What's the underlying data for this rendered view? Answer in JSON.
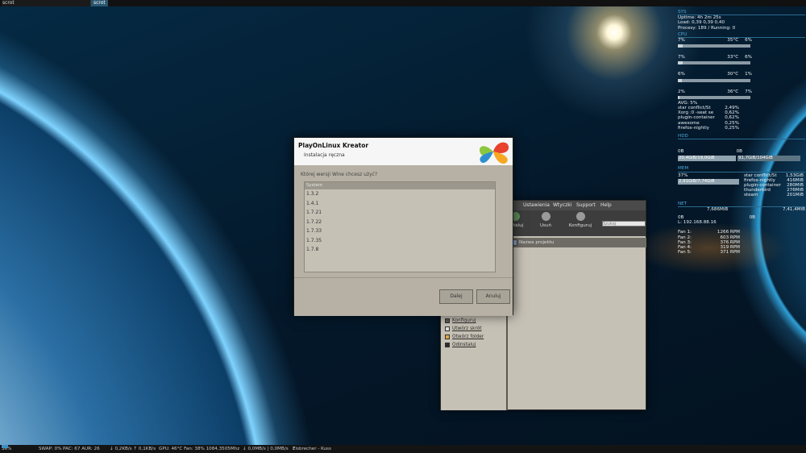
{
  "topbar": {
    "prompt": "scrot",
    "tag": "scrot"
  },
  "conky": {
    "sys_header": "SYS",
    "uptime": "Uptime: 4h 2m 25s",
    "load": "Load: 0,39 0,39 0,40",
    "processes": "Procesy: 189 / Running: 0",
    "cpu_header": "CPU",
    "cores": [
      {
        "usage": "7%",
        "temp": "35°C",
        "freq": "6%",
        "fill": 0.07
      },
      {
        "usage": "7%",
        "temp": "33°C",
        "freq": "6%",
        "fill": 0.07
      },
      {
        "usage": "6%",
        "temp": "30°C",
        "freq": "1%",
        "fill": 0.06
      },
      {
        "usage": "2%",
        "temp": "36°C",
        "freq": "7%",
        "fill": 0.02
      }
    ],
    "avg": "AVG: 5%",
    "cpu_procs": [
      {
        "name": "star conflict/St",
        "value": "2,49%"
      },
      {
        "name": "Xorg :0 -seat se",
        "value": "0,62%"
      },
      {
        "name": "plugin-container",
        "value": "0,62%"
      },
      {
        "name": "awesome",
        "value": "0,25%"
      },
      {
        "name": "firefox-nightly",
        "value": "0,25%"
      }
    ],
    "hdd_header": "HDD",
    "hdd_left_label": "0B",
    "hdd_right_label": "0B",
    "hdd_left": "20,4GiB/19,0GiB",
    "hdd_right": "91,7GiB/104GiB",
    "mem_header": "MEM",
    "mem_percent": "37%",
    "mem_used": "2,91GiB/7,74GiB",
    "mem_fill": 0.37,
    "mem_procs": [
      {
        "name": "star conflict/St",
        "value": "1,53GiB"
      },
      {
        "name": "firefox-nightly",
        "value": "416MiB"
      },
      {
        "name": "plugin-container",
        "value": "280MiB"
      },
      {
        "name": "thunderbird",
        "value": "276MiB"
      },
      {
        "name": "steam",
        "value": "201MiB"
      }
    ],
    "net_header": "NET",
    "net_down": "7,686MiB",
    "net_up": "7,41,4MiB",
    "net_down_rate": "0B",
    "net_up_rate": "0B",
    "lan_ip": "L: 192.168.88.16",
    "fans": [
      {
        "name": "Fan 1:",
        "rpm": "1266 RPM"
      },
      {
        "name": "Fan 2:",
        "rpm": "603 RPM"
      },
      {
        "name": "Fan 3:",
        "rpm": "376 RPM"
      },
      {
        "name": "Fan 4:",
        "rpm": "319 RPM"
      },
      {
        "name": "Fan 5:",
        "rpm": "371 RPM"
      }
    ]
  },
  "mainwin": {
    "menu": [
      "Ustawienia",
      "Wtyczki",
      "Support",
      "Help"
    ],
    "tools": [
      "Instaluj",
      "Usuń",
      "Konfiguruj"
    ],
    "search_placeholder": "Szukaj",
    "list_header": "Nazwa projektu",
    "actions": [
      "Konfiguruj",
      "Utwórz skrót",
      "Otwórz folder",
      "Odinstaluj"
    ]
  },
  "dialog": {
    "title": "PlayOnLinux Kreator",
    "subtitle": "Instalacja ręczna",
    "question": "Której wersji Wine chcesz użyć?",
    "list_header": "System",
    "versions": [
      "1.3.2",
      "1.4.1",
      "1.7.21",
      "1.7.22",
      "1.7.33",
      "1.7.35",
      "1.7.8"
    ],
    "next_button": "Dalej",
    "cancel_button": "Anuluj"
  },
  "bottombar": {
    "battery": "36%",
    "swap": "SWAP: 0%",
    "pac": "PAC: 67 AUR: 26",
    "net": "↓ 0,2KB/s ↑ 0,1KB/s",
    "gpu": "GPU: 46°C Fan: 38% 1084,3505Mhz",
    "disk": "↓ 0,0MB/s | 0,0MB/s",
    "music": "Eisbrecher - Kuss"
  },
  "colors": {
    "accent": "#4ca7d8",
    "dialog_bg": "#b6b1a4",
    "window_bg": "#c6c1b5"
  }
}
